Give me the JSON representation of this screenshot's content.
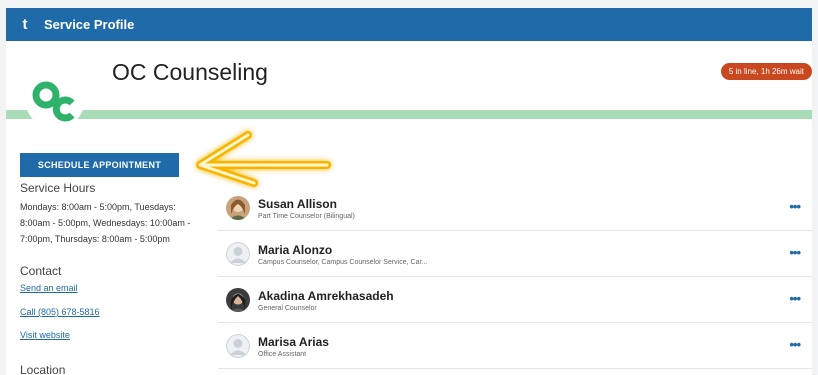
{
  "topbar": {
    "logo": "t",
    "title": "Service Profile"
  },
  "header": {
    "title": "OC Counseling",
    "wait_badge": "5 in line, 1h 26m wait"
  },
  "colors": {
    "brand_blue": "#1f6aa8",
    "accent_green": "#2fb36b",
    "badge_orange": "#c9481f",
    "arrow_yellow": "#f7b500"
  },
  "schedule_button": {
    "label": "SCHEDULE APPOINTMENT"
  },
  "service_hours": {
    "heading": "Service Hours",
    "lines": [
      "Mondays: 8:00am - 5:00pm, Tuesdays:",
      "8:00am - 5:00pm, Wednesdays: 10:00am -",
      "7:00pm, Thursdays: 8:00am - 5:00pm"
    ]
  },
  "contact": {
    "heading": "Contact",
    "email": "Send an email",
    "phone": "Call (805) 678-5816",
    "website": "Visit website"
  },
  "location": {
    "heading": "Location"
  },
  "staff": [
    {
      "name": "Susan Allison",
      "role": "Part Time Counselor (Bilingual)",
      "avatar": "photo-avatar"
    },
    {
      "name": "Maria Alonzo",
      "role": "Campus Counselor, Campus Counselor Service, Car...",
      "avatar": "default-avatar"
    },
    {
      "name": "Akadina Amrekhasadeh",
      "role": "General Counselor",
      "avatar": "photo-avatar"
    },
    {
      "name": "Marisa Arias",
      "role": "Office Assistant",
      "avatar": "default-avatar"
    }
  ],
  "more_icon": "•••"
}
